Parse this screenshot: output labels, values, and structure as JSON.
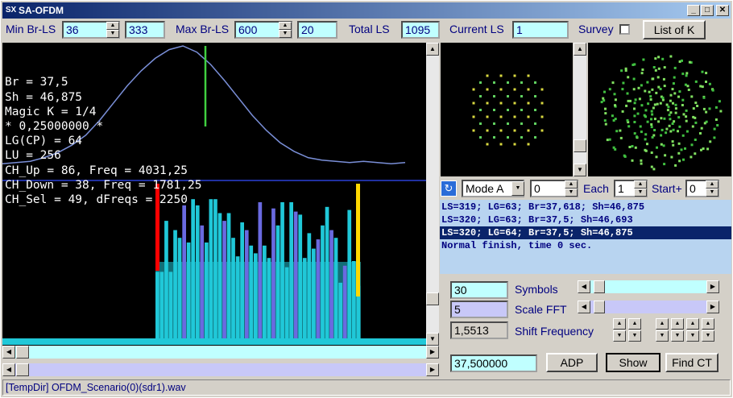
{
  "window": {
    "title": "SA-OFDM",
    "min_label": "_",
    "max_label": "□",
    "close_label": "✕"
  },
  "top": {
    "min_br_label": "Min Br-LS",
    "min_br_value": "36",
    "min_br_aux": "333",
    "max_br_label": "Max Br-LS",
    "max_br_value": "600",
    "max_br_aux": "20",
    "total_ls_label": "Total LS",
    "total_ls_value": "1095",
    "current_ls_label": "Current LS",
    "current_ls_value": "1",
    "survey_label": "Survey",
    "list_button": "List of K"
  },
  "info_lines": [
    "Br = 37,5",
    "Sh = 46,875",
    "Magic K = 1/4",
    "* 0,25000000 *",
    "LG(CP) = 64",
    "LU = 256",
    "CH_Up = 86, Freq = 4031,25",
    "CH_Down = 38, Freq = 1781,25",
    "CH_Sel = 49, dFreqs = 2250"
  ],
  "mode": {
    "value": "Mode A",
    "field_value": "0",
    "each_label": "Each",
    "each_value": "1",
    "start_label": "Start+",
    "start_value": "0"
  },
  "log": {
    "lines": [
      "LS=319; LG=63; Br=37,618; Sh=46,875",
      "LS=320; LG=63; Br=37,5; Sh=46,693",
      "LS=320; LG=64; Br=37,5; Sh=46,875",
      "Normal finish, time 0 sec."
    ],
    "selected_index": 2
  },
  "controls": {
    "symbols_value": "30",
    "symbols_label": "Symbols",
    "scale_value": "5",
    "scale_label": "Scale FFT",
    "shift_value": "1,5513",
    "shift_label": "Shift Frequency",
    "br_value": "37,500000",
    "adp_button": "ADP",
    "show_button": "Show",
    "find_button": "Find CT"
  },
  "status": {
    "text": "[TempDir] OFDM_Scenario(0)(sdr1).wav"
  },
  "colors": {
    "plot_bg": "#000000",
    "curve": "#7a8fd8",
    "cyan_bar": "#20c8d8",
    "violet_bar": "#6a6ae0",
    "red_marker": "#ff0000",
    "yellow_marker": "#ffd800",
    "green_marker": "#40d040"
  },
  "chart_data": {
    "type": "bar",
    "title": "",
    "bars": [
      {
        "color": "c",
        "level": 0.43
      },
      {
        "color": "c",
        "level": 0.43
      },
      {
        "color": "c",
        "level": 0.76
      },
      {
        "color": "c",
        "level": 0.43
      },
      {
        "color": "c",
        "level": 0.7
      },
      {
        "color": "c",
        "level": 0.65
      },
      {
        "color": "v",
        "level": 0.86
      },
      {
        "color": "c",
        "level": 0.62
      },
      {
        "color": "c",
        "level": 0.9
      },
      {
        "color": "c",
        "level": 0.86
      },
      {
        "color": "v",
        "level": 0.73
      },
      {
        "color": "c",
        "level": 0.62
      },
      {
        "color": "c",
        "level": 0.9
      },
      {
        "color": "c",
        "level": 0.9
      },
      {
        "color": "c",
        "level": 0.81
      },
      {
        "color": "v",
        "level": 0.76
      },
      {
        "color": "c",
        "level": 0.81
      },
      {
        "color": "c",
        "level": 0.65
      },
      {
        "color": "c",
        "level": 0.53
      },
      {
        "color": "c",
        "level": 0.75
      },
      {
        "color": "v",
        "level": 0.7
      },
      {
        "color": "c",
        "level": 0.6
      },
      {
        "color": "c",
        "level": 0.55
      },
      {
        "color": "v",
        "level": 0.88
      },
      {
        "color": "c",
        "level": 0.6
      },
      {
        "color": "c",
        "level": 0.52
      },
      {
        "color": "v",
        "level": 0.84
      },
      {
        "color": "c",
        "level": 0.73
      },
      {
        "color": "c",
        "level": 0.88
      },
      {
        "color": "c",
        "level": 0.46
      },
      {
        "color": "c",
        "level": 0.88
      },
      {
        "color": "v",
        "level": 0.82
      },
      {
        "color": "c",
        "level": 0.8
      },
      {
        "color": "c",
        "level": 0.52
      },
      {
        "color": "c",
        "level": 0.68
      },
      {
        "color": "c",
        "level": 0.58
      },
      {
        "color": "v",
        "level": 0.64
      },
      {
        "color": "c",
        "level": 0.73
      },
      {
        "color": "c",
        "level": 0.85
      },
      {
        "color": "v",
        "level": 0.7
      },
      {
        "color": "c",
        "level": 0.65
      },
      {
        "color": "c",
        "level": 0.36
      },
      {
        "color": "v",
        "level": 0.47
      },
      {
        "color": "c",
        "level": 0.83
      },
      {
        "color": "c",
        "level": 0.5
      },
      {
        "color": "c",
        "level": 0.34
      }
    ],
    "markers": [
      {
        "color": "red",
        "position": 0.0
      },
      {
        "color": "yellow",
        "position": 1.0
      }
    ],
    "curve": [
      0.05,
      0.06,
      0.07,
      0.1,
      0.14,
      0.2,
      0.28,
      0.4,
      0.54,
      0.68,
      0.8,
      0.9,
      0.97,
      1.0,
      0.95,
      0.85,
      0.72,
      0.58,
      0.44,
      0.32,
      0.22,
      0.15,
      0.1,
      0.08,
      0.07,
      0.06,
      0.07,
      0.06,
      0.05,
      0.06
    ]
  }
}
